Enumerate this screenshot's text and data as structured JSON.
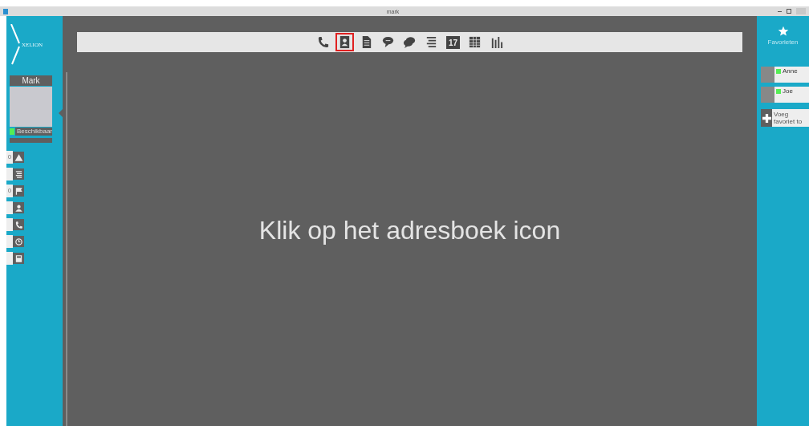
{
  "window": {
    "title": "mark"
  },
  "logo": "XELION",
  "user": {
    "name": "Mark",
    "status": "Beschikbaar",
    "available": true
  },
  "side_buttons": [
    {
      "kind": "warning",
      "count": "0"
    },
    {
      "kind": "list"
    },
    {
      "kind": "flag",
      "count": "0"
    },
    {
      "kind": "contact"
    },
    {
      "kind": "phone"
    },
    {
      "kind": "history"
    },
    {
      "kind": "calculator"
    }
  ],
  "toolbar": [
    {
      "kind": "phone",
      "selected": false
    },
    {
      "kind": "addressbook",
      "selected": true
    },
    {
      "kind": "document",
      "selected": false
    },
    {
      "kind": "chat",
      "selected": false
    },
    {
      "kind": "chats",
      "selected": false
    },
    {
      "kind": "list",
      "selected": false
    },
    {
      "kind": "calendar",
      "selected": false,
      "day": "17"
    },
    {
      "kind": "table",
      "selected": false
    },
    {
      "kind": "barchart",
      "selected": false
    }
  ],
  "caption": "Klik op het adresboek icon",
  "favorites": {
    "title": "Favorieten",
    "items": [
      {
        "name": "Anne",
        "color": "#55ee55"
      },
      {
        "name": "Joe",
        "color": "#55ee55"
      }
    ],
    "add_label": "Voeg favoriet to"
  }
}
